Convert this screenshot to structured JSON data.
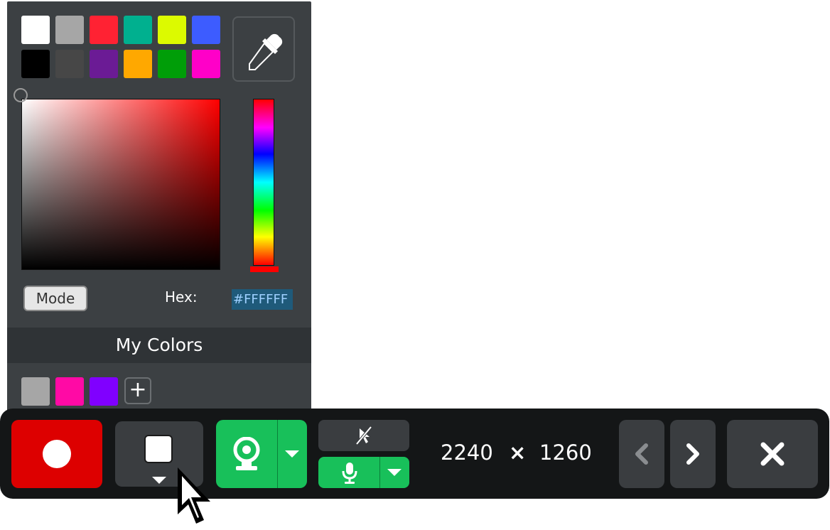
{
  "picker": {
    "preset_swatches": [
      {
        "name": "white",
        "color": "#ffffff"
      },
      {
        "name": "gray",
        "color": "#a6a6a6"
      },
      {
        "name": "red",
        "color": "#ff2233"
      },
      {
        "name": "teal",
        "color": "#00b08f"
      },
      {
        "name": "yellow-green",
        "color": "#dcfa00"
      },
      {
        "name": "blue",
        "color": "#3d5cff"
      },
      {
        "name": "black",
        "color": "#000000"
      },
      {
        "name": "dark-gray",
        "color": "#474747"
      },
      {
        "name": "purple",
        "color": "#6b1b95"
      },
      {
        "name": "orange",
        "color": "#ffa800"
      },
      {
        "name": "green",
        "color": "#009e08"
      },
      {
        "name": "magenta",
        "color": "#ff00c8"
      }
    ],
    "hue_color": "#ff0000",
    "mode_label": "Mode",
    "hex_label": "Hex:",
    "hex_value": "#FFFFFF",
    "my_colors_title": "My Colors",
    "my_colors": [
      {
        "name": "gray",
        "color": "#a6a6a6"
      },
      {
        "name": "pink",
        "color": "#ff0aa5"
      },
      {
        "name": "violet",
        "color": "#8000ff"
      }
    ],
    "add_label": "+"
  },
  "toolbar": {
    "selected_color": "#ffffff",
    "width": "2240",
    "times": "×",
    "height": "1260"
  },
  "colors": {
    "record": "#dd0000",
    "green": "#18c05a",
    "panel": "#3c4043",
    "toolbar_bg": "#141617"
  }
}
